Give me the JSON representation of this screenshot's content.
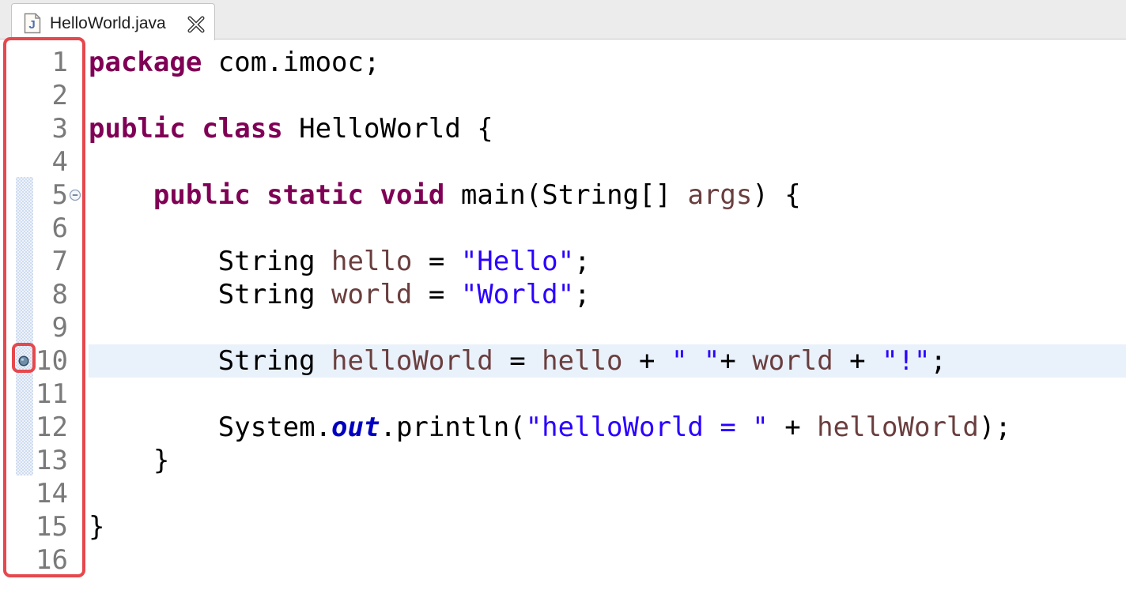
{
  "tab": {
    "file_icon": "java-file-icon",
    "file_icon_letter": "J",
    "label": "HelloWorld.java",
    "close_icon": "close-icon"
  },
  "editor": {
    "line_numbers": [
      "1",
      "2",
      "3",
      "4",
      "5",
      "6",
      "7",
      "8",
      "9",
      "10",
      "11",
      "12",
      "13",
      "14",
      "15",
      "16"
    ],
    "current_line": 10,
    "breakpoint_line": 10,
    "fold_line": 5,
    "change_ruler_lines": [
      5,
      13
    ],
    "lines": [
      [
        {
          "t": "package",
          "c": "kw"
        },
        {
          "t": " com.imooc;",
          "c": ""
        }
      ],
      [],
      [
        {
          "t": "public",
          "c": "kw"
        },
        {
          "t": " ",
          "c": ""
        },
        {
          "t": "class",
          "c": "kw"
        },
        {
          "t": " HelloWorld {",
          "c": ""
        }
      ],
      [],
      [
        {
          "t": "    ",
          "c": ""
        },
        {
          "t": "public",
          "c": "kw"
        },
        {
          "t": " ",
          "c": ""
        },
        {
          "t": "static",
          "c": "kw"
        },
        {
          "t": " ",
          "c": ""
        },
        {
          "t": "void",
          "c": "kw"
        },
        {
          "t": " main(String[] ",
          "c": ""
        },
        {
          "t": "args",
          "c": "var"
        },
        {
          "t": ") {",
          "c": ""
        }
      ],
      [],
      [
        {
          "t": "        String ",
          "c": ""
        },
        {
          "t": "hello",
          "c": "var"
        },
        {
          "t": " = ",
          "c": ""
        },
        {
          "t": "\"Hello\"",
          "c": "str"
        },
        {
          "t": ";",
          "c": ""
        }
      ],
      [
        {
          "t": "        String ",
          "c": ""
        },
        {
          "t": "world",
          "c": "var"
        },
        {
          "t": " = ",
          "c": ""
        },
        {
          "t": "\"World\"",
          "c": "str"
        },
        {
          "t": ";",
          "c": ""
        }
      ],
      [],
      [
        {
          "t": "        String ",
          "c": ""
        },
        {
          "t": "helloWorld",
          "c": "var"
        },
        {
          "t": " = ",
          "c": ""
        },
        {
          "t": "hello",
          "c": "var"
        },
        {
          "t": " + ",
          "c": ""
        },
        {
          "t": "\" \"",
          "c": "str"
        },
        {
          "t": "+ ",
          "c": ""
        },
        {
          "t": "world",
          "c": "var"
        },
        {
          "t": " + ",
          "c": ""
        },
        {
          "t": "\"!\"",
          "c": "str"
        },
        {
          "t": ";",
          "c": ""
        }
      ],
      [],
      [
        {
          "t": "        System.",
          "c": ""
        },
        {
          "t": "out",
          "c": "field"
        },
        {
          "t": ".println(",
          "c": ""
        },
        {
          "t": "\"helloWorld = \"",
          "c": "str"
        },
        {
          "t": " + ",
          "c": ""
        },
        {
          "t": "helloWorld",
          "c": "var"
        },
        {
          "t": ");",
          "c": ""
        }
      ],
      [
        {
          "t": "    }",
          "c": ""
        }
      ],
      [],
      [
        {
          "t": "}",
          "c": ""
        }
      ],
      []
    ]
  },
  "colors": {
    "keyword": "#7f0055",
    "string": "#2a00ff",
    "local_variable": "#6a3e3e",
    "static_field": "#0000c0",
    "current_line_bg": "#e9f1fb",
    "annotation_red": "#e5484d"
  },
  "icons": {
    "fold": "collapse-icon",
    "breakpoint": "breakpoint-icon"
  }
}
